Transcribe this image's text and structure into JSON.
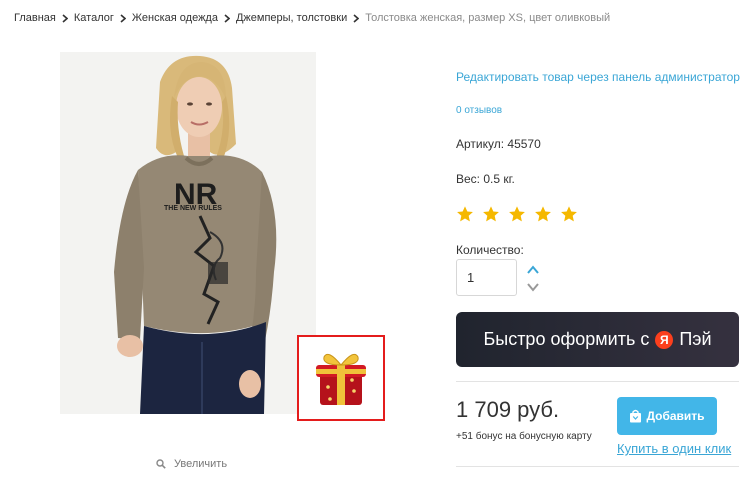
{
  "breadcrumb": {
    "items": [
      "Главная",
      "Каталог",
      "Женская одежда",
      "Джемперы, толстовки"
    ],
    "current": "Толстовка женская, размер XS, цвет оливковый"
  },
  "product": {
    "photo_print_text": "NR",
    "photo_print_subtext": "THE NEW RULES",
    "zoom_label": "Увеличить"
  },
  "info": {
    "edit_link": "Редактировать товар через панель администратора",
    "reviews": "0 отзывов",
    "sku": "Артикул: 45570",
    "weight": "Вес: 0.5 кг.",
    "rating": 5,
    "star_color": "#f5b800"
  },
  "quantity": {
    "label": "Количество:",
    "value": "1"
  },
  "yapay": {
    "text": "Быстро оформить с",
    "logo_letter": "Я",
    "brand": "Пэй"
  },
  "purchase": {
    "price": "1 709 руб.",
    "bonus": "+51 бонус на бонусную карту",
    "add_label": "Добавить",
    "one_click": "Купить в один клик"
  },
  "colors": {
    "accent": "#3aa6d6",
    "button": "#42b6e8",
    "highlight_border": "#e41c1c"
  }
}
